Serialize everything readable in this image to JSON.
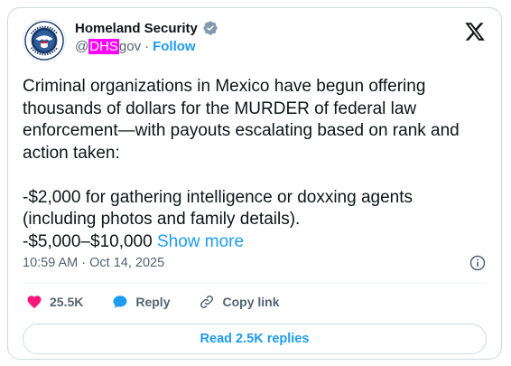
{
  "account": {
    "name": "Homeland Security",
    "handle_prefix": "@",
    "handle_highlight": "DHS",
    "handle_suffix": "gov",
    "separator": "·",
    "follow_label": "Follow",
    "avatar_icon": "dhs-seal-icon",
    "verified_icon": "verified-badge-icon",
    "verified_color": "#829aab"
  },
  "platform_icon": "x-logo-icon",
  "post": {
    "text": "Criminal organizations in Mexico have begun offering thousands of dollars for the MURDER of federal law enforcement—with payouts escalating based on rank and action taken:\n\n-$2,000 for gathering intelligence or doxxing agents (including photos and family details).\n-$5,000–$10,000 ",
    "show_more": "Show more",
    "timestamp": "10:59 AM · Oct 14, 2025"
  },
  "actions": {
    "likes": "25.5K",
    "reply_label": "Reply",
    "copy_link_label": "Copy link"
  },
  "read_replies_label": "Read 2.5K replies",
  "colors": {
    "accent": "#1d9bf0",
    "like": "#f91880",
    "highlight": "#ff00ff"
  }
}
